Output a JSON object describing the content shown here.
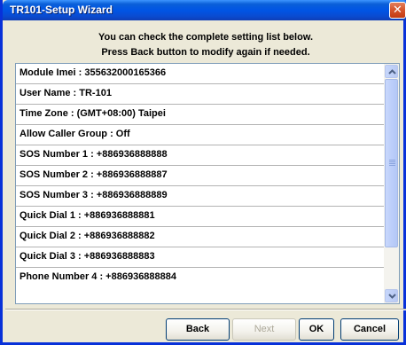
{
  "window": {
    "title": "TR101-Setup Wizard",
    "close_symbol": "✕"
  },
  "instructions": {
    "line1": "You can check the complete setting list below.",
    "line2": "Press Back button to modify again if needed."
  },
  "settings_list": {
    "items": [
      {
        "label": "Module Imei : 355632000165366"
      },
      {
        "label": "User Name : TR-101"
      },
      {
        "label": "Time Zone : (GMT+08:00) Taipei"
      },
      {
        "label": "Allow Caller Group : Off"
      },
      {
        "label": "SOS Number 1 : +886936888888"
      },
      {
        "label": "SOS Number 2 : +886936888887"
      },
      {
        "label": "SOS Number 3 : +886936888889"
      },
      {
        "label": "Quick Dial 1 : +886936888881"
      },
      {
        "label": "Quick Dial 2 : +886936888882"
      },
      {
        "label": "Quick Dial 3 : +886936888883"
      },
      {
        "label": "Phone Number 4 : +886936888884"
      }
    ]
  },
  "buttons": {
    "back": "Back",
    "next": "Next",
    "ok": "OK",
    "cancel": "Cancel"
  }
}
